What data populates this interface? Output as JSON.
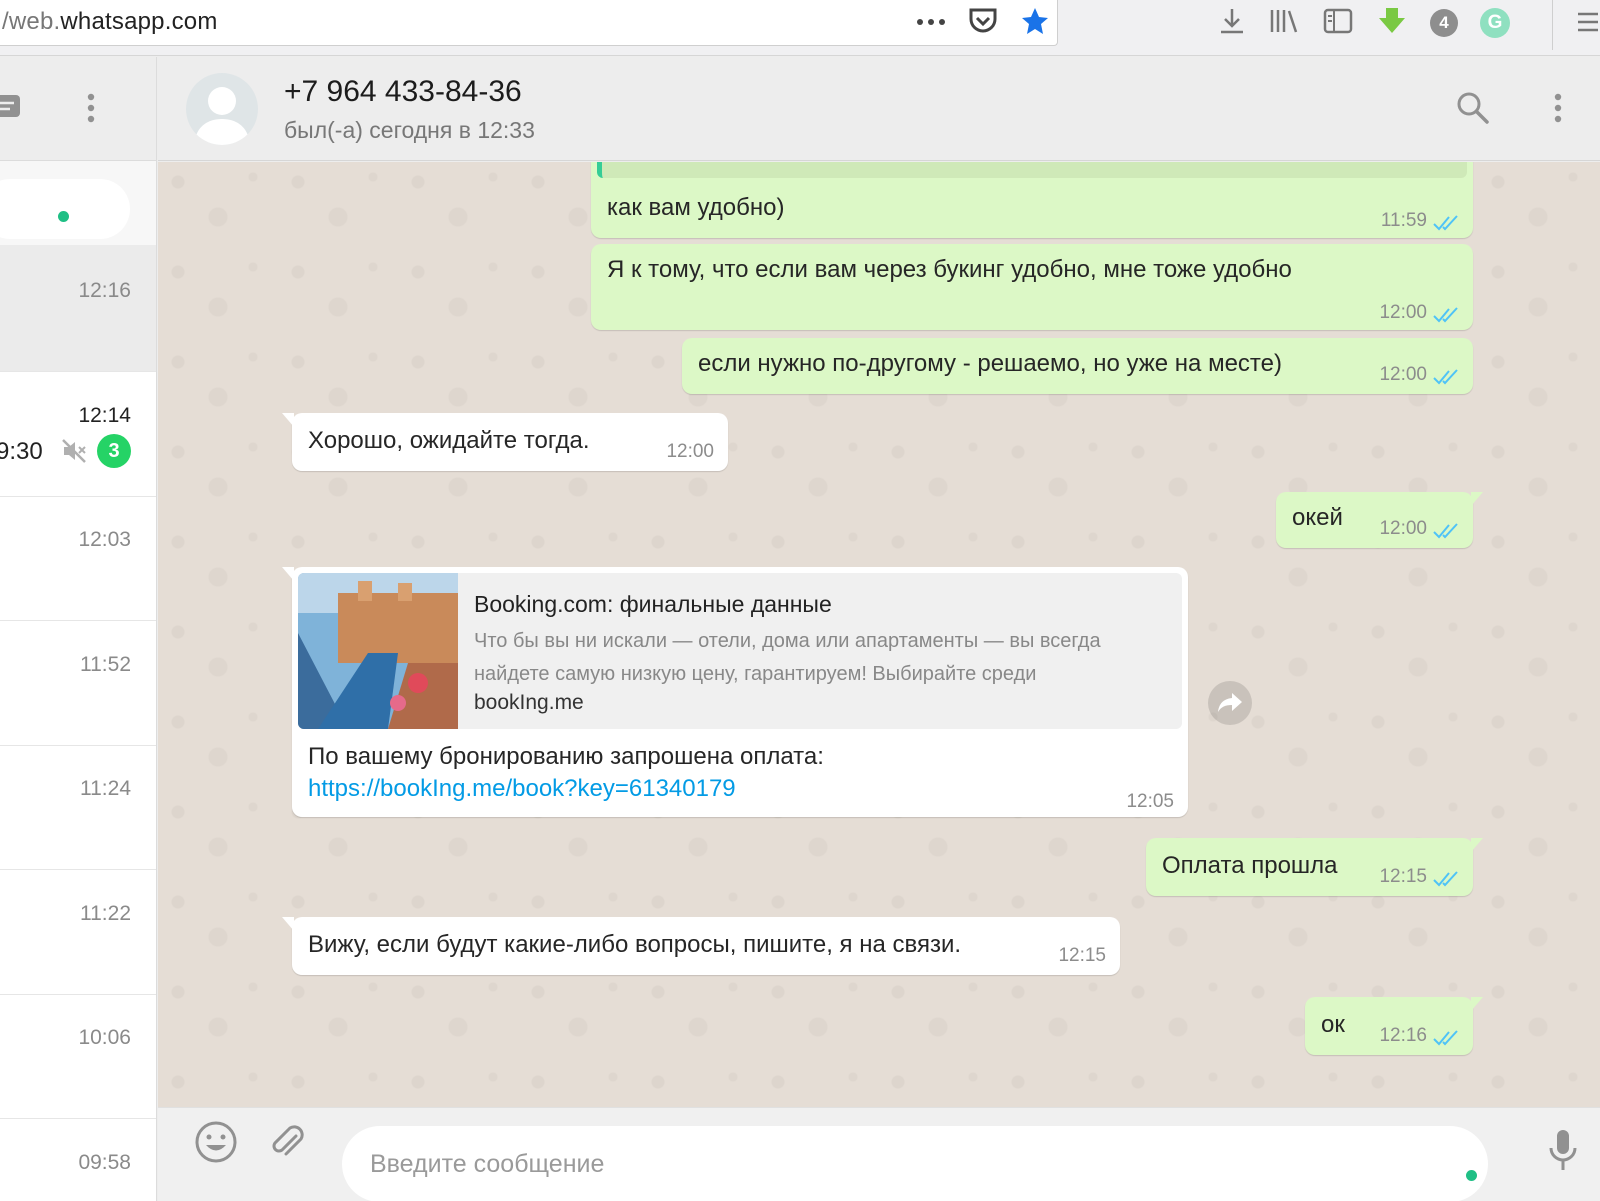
{
  "browser": {
    "url_prefix": "/web.",
    "url_domain": "whatsapp.com",
    "badge_count": "4",
    "icons": [
      "more-icon",
      "pocket-icon",
      "bookmark-star-icon",
      "download-icon",
      "library-icon",
      "reader-icon",
      "extension-arrow-icon",
      "badge-icon",
      "grammarly-icon",
      "menu-icon"
    ]
  },
  "sidebar": {
    "chats": [
      {
        "time": "12:16",
        "active": true
      },
      {
        "time": "12:14",
        "fragment": "9:30",
        "muted": true,
        "unread": "3"
      },
      {
        "time": "12:03"
      },
      {
        "time": "11:52"
      },
      {
        "time": "11:24"
      },
      {
        "time": "11:22"
      },
      {
        "time": "10:06"
      },
      {
        "time": "09:58"
      }
    ]
  },
  "header": {
    "name": "+7 964 433-84-36",
    "status": "был(-а) сегодня в 12:33"
  },
  "messages": [
    {
      "dir": "out",
      "text": "как вам удобно)",
      "time": "11:59"
    },
    {
      "dir": "out",
      "text": "Я к тому, что если вам через букинг удобно, мне тоже удобно",
      "time": "12:00"
    },
    {
      "dir": "out",
      "text": "если нужно по-другому - решаемо, но уже на месте)",
      "time": "12:00"
    },
    {
      "dir": "in",
      "text": "Хорошо, ожидайте тогда.",
      "time": "12:00"
    },
    {
      "dir": "out",
      "text": "окей",
      "time": "12:00"
    },
    {
      "dir": "in",
      "preview": {
        "title": "Booking.com: финальные данные",
        "description": "Что бы вы ни искали — отели, дома или апартаменты — вы всегда найдете самую низкую цену, гарантируем! Выбирайте среди",
        "domain": "bookIng.me"
      },
      "text": "По вашему бронированию запрошена оплата:",
      "link": "https://bookIng.me/book?key=61340179",
      "time": "12:05"
    },
    {
      "dir": "out",
      "text": "Оплата прошла",
      "time": "12:15"
    },
    {
      "dir": "in",
      "text": "Вижу, если будут какие-либо вопросы, пишите, я на связи.",
      "time": "12:15"
    },
    {
      "dir": "out",
      "text": "ок",
      "time": "12:16"
    }
  ],
  "composer": {
    "placeholder": "Введите сообщение"
  },
  "colors": {
    "outgoing_bubble": "#dcf8c6",
    "incoming_bubble": "#ffffff",
    "tick_read": "#4fc3f7",
    "badge_green": "#25d366",
    "link": "#039be5"
  }
}
